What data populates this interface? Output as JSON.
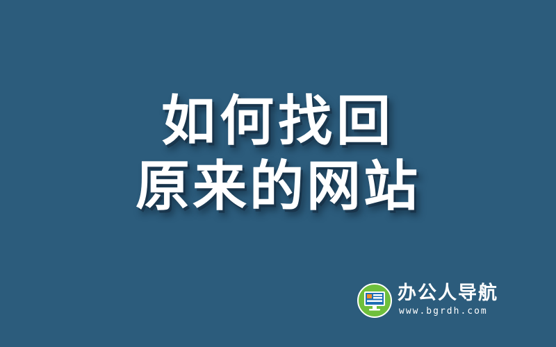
{
  "title": {
    "line1": "如何找回",
    "line2": "原来的网站"
  },
  "brand": {
    "name": "办公人导航",
    "url": "www.bgrdh.com",
    "logo_icon": "monitor-icon"
  },
  "colors": {
    "background": "#2c5c7c",
    "text": "#ffffff",
    "logo_green": "#6fbf3c",
    "logo_screen": "#1f6fb5",
    "logo_orange": "#f28c28"
  }
}
